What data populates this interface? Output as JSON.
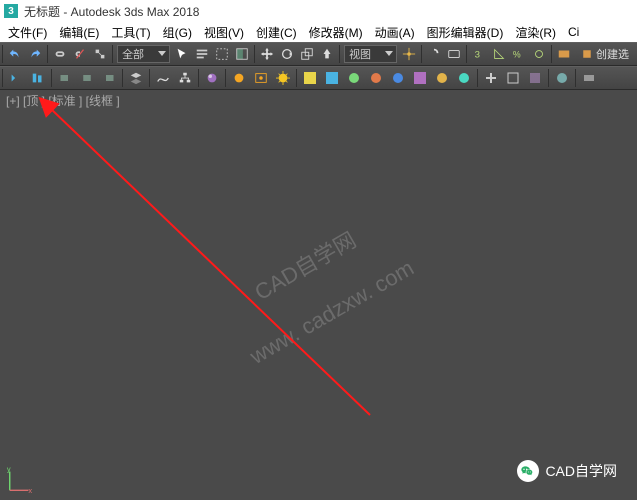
{
  "titlebar": {
    "icon_text": "3",
    "title": "无标题 - Autodesk 3ds Max 2018"
  },
  "menu": {
    "items": [
      "文件(F)",
      "编辑(E)",
      "工具(T)",
      "组(G)",
      "视图(V)",
      "创建(C)",
      "修改器(M)",
      "动画(A)",
      "图形编辑器(D)",
      "渲染(R)",
      "Ci"
    ]
  },
  "toolbar1": {
    "dropdown_all": "全部",
    "view_label": "视图",
    "create_label": "创建选"
  },
  "viewport": {
    "label": "[+] [顶 ] [标准 ] [线框 ]"
  },
  "watermark": {
    "line1": "CAD自学网",
    "line2": "www. cadzxw. com"
  },
  "footer": {
    "brand": "CAD自学网"
  },
  "axis": {
    "x": "x",
    "y": "y"
  }
}
